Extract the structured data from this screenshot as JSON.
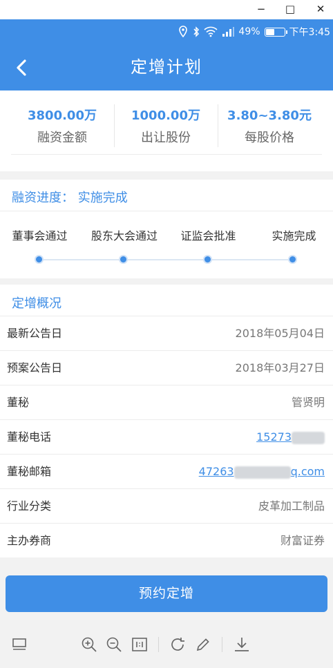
{
  "window_controls": {
    "minimize": "−",
    "maximize": "□",
    "close": "✕"
  },
  "status_bar": {
    "battery": "49%",
    "battery_level": 0.49,
    "time": "下午3:45"
  },
  "nav": {
    "title": "定增计划"
  },
  "stats": [
    {
      "value": "3800.00万",
      "label": "融资金额"
    },
    {
      "value": "1000.00万",
      "label": "出让股份"
    },
    {
      "value": "3.80~3.80元",
      "label": "每股价格"
    }
  ],
  "progress": {
    "title": "融资进度： 实施完成",
    "steps": [
      "董事会通过",
      "股东大会通过",
      "证监会批准",
      "实施完成"
    ]
  },
  "overview": {
    "title": "定增概况",
    "rows": [
      {
        "key": "最新公告日",
        "value": "2018年05月04日"
      },
      {
        "key": "预案公告日",
        "value": "2018年03月27日"
      },
      {
        "key": "董秘",
        "value": "管贤明"
      },
      {
        "key": "董秘电话",
        "value": "15273"
      },
      {
        "key": "董秘邮箱",
        "value_start": "47263",
        "value_end": "q.com"
      },
      {
        "key": "行业分类",
        "value": "皮革加工制品"
      },
      {
        "key": "主办券商",
        "value": "财富证券"
      }
    ]
  },
  "cta": {
    "label": "预约定增"
  },
  "colors": {
    "accent": "#3f8ee6"
  }
}
